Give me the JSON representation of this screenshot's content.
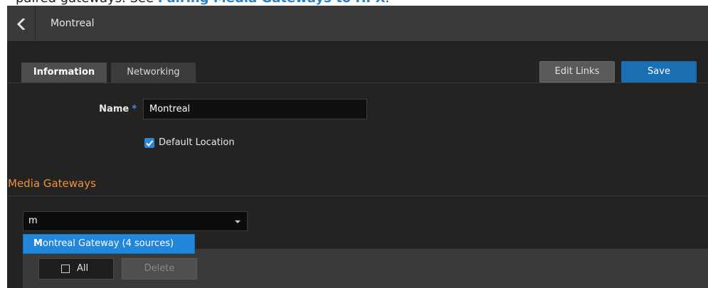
{
  "doc": {
    "text_before": "paired gateways. See ",
    "link": "Pairing Media Gateways to HPX",
    "text_after": "."
  },
  "header": {
    "title": "Montreal"
  },
  "tabs": [
    {
      "label": "Information",
      "active": true
    },
    {
      "label": "Networking",
      "active": false
    }
  ],
  "toolbar": {
    "edit_links_label": "Edit Links",
    "save_label": "Save"
  },
  "form": {
    "name_label": "Name",
    "required_marker": "*",
    "name_value": "Montreal",
    "default_location_label": "Default Location",
    "default_location_checked": true
  },
  "media_gateways": {
    "section_title": "Media Gateways",
    "search_value": "m",
    "dropdown_options": [
      {
        "match": "M",
        "rest": "ontreal Gateway (4 sources)"
      }
    ],
    "all_label": "All",
    "all_checked": false,
    "delete_label": "Delete"
  },
  "colors": {
    "accent_orange": "#f0923a",
    "primary_blue": "#1a6fb3",
    "highlight_blue": "#2286d9",
    "doc_link": "#2b7fc4"
  },
  "icons": {
    "back": "chevron-left-icon",
    "dropdown": "caret-down-icon",
    "checkbox": "checkmark-icon"
  }
}
